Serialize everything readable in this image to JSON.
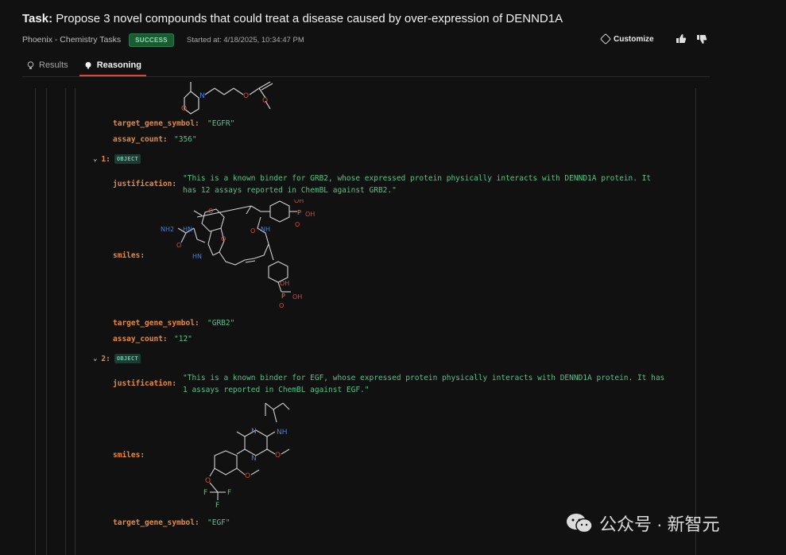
{
  "header": {
    "task_label": "Task",
    "task_text": "Propose 3 novel compounds that could treat a disease caused by over-expression of DENND1A",
    "app_name": "Phoenix - Chemistry Tasks",
    "status": "SUCCESS",
    "started_at": "Started at: 4/18/2025, 10:34:47 PM",
    "customize_label": "Customize"
  },
  "tabs": [
    {
      "label": "Results",
      "icon": "lightbulb-icon"
    },
    {
      "label": "Reasoning",
      "icon": "brain-icon"
    }
  ],
  "entries": {
    "item0": {
      "target_gene_symbol_key": "target_gene_symbol:",
      "target_gene_symbol": "\"EGFR\"",
      "assay_count_key": "assay_count:",
      "assay_count": "\"356\""
    },
    "item1": {
      "index": "1:",
      "type": "OBJECT",
      "justification_key": "justification:",
      "justification_line1": "\"This is a known binder for GRB2, whose expressed protein physically interacts with DENND1A protein. It",
      "justification_line2": "has 12 assays reported in ChemBL against GRB2.\"",
      "smiles_key": "smiles:",
      "target_gene_symbol_key": "target_gene_symbol:",
      "target_gene_symbol": "\"GRB2\"",
      "assay_count_key": "assay_count:",
      "assay_count": "\"12\"",
      "atom_labels": {
        "oh": "OH",
        "p": "P",
        "o": "O",
        "nh2": "NH2",
        "hn": "HN",
        "n": "N",
        "nh": "NH"
      }
    },
    "item2": {
      "index": "2:",
      "type": "OBJECT",
      "justification_key": "justification:",
      "justification_line1": "\"This is a known binder for EGF, whose expressed protein physically interacts with DENND1A protein. It has",
      "justification_line2": "1 assays reported in ChemBL against EGF.\"",
      "smiles_key": "smiles:",
      "target_gene_symbol_key": "target_gene_symbol:",
      "target_gene_symbol": "\"EGF\"",
      "atom_labels": {
        "n": "N",
        "nh": "NH",
        "o": "O",
        "f": "F"
      }
    }
  },
  "watermark": {
    "text": "公众号 · 新智元"
  },
  "colors": {
    "background": "#111111",
    "key": "#e58a41",
    "string_value": "#58c08a",
    "badge_success_bg": "#1c5a33",
    "tab_accent": "#d9463c",
    "nitrogen": "#4a7fd8",
    "oxygen": "#d94a3c",
    "phosphorus": "#e08a3a",
    "fluorine": "#5fc07a"
  }
}
